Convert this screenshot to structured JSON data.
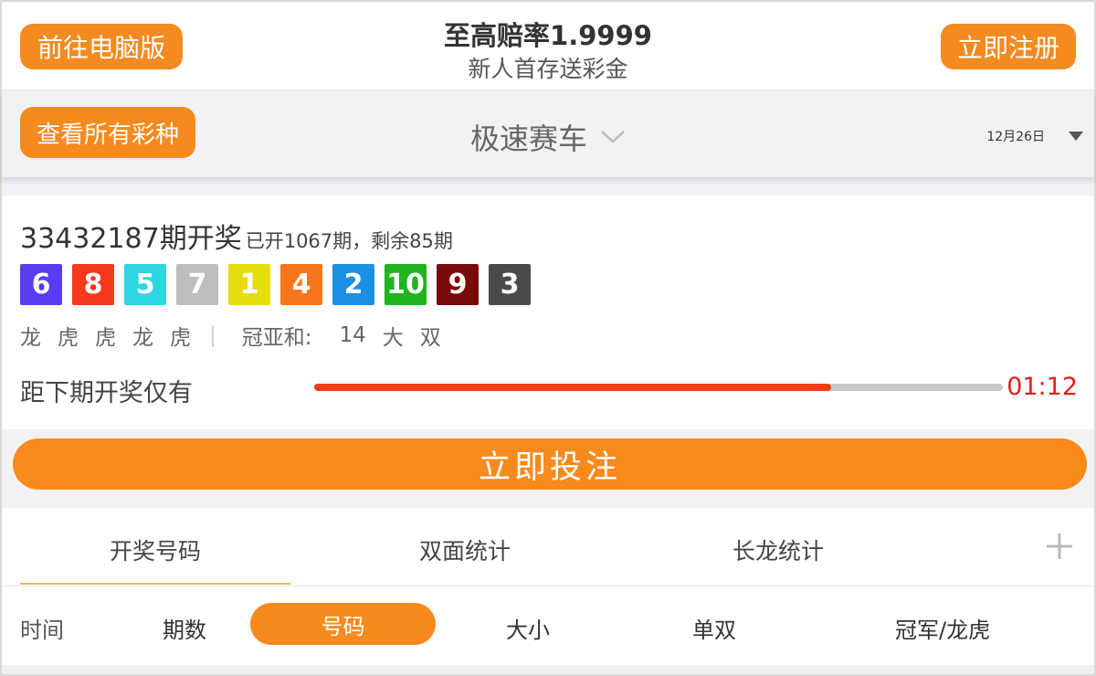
{
  "header": {
    "desktop_button": "前往电脑版",
    "promo_title": "至高赔率1.9999",
    "promo_subtitle": "新人首存送彩金",
    "register_button": "立即注册"
  },
  "selector": {
    "all_lotteries_button": "查看所有彩种",
    "lottery_name": "极速赛车",
    "date": "12月26日"
  },
  "result": {
    "issue": "33432187期开奖",
    "stats": "已开1067期，剩余85期",
    "balls": [
      {
        "num": "6",
        "color": "#5b3df0"
      },
      {
        "num": "8",
        "color": "#f4391c"
      },
      {
        "num": "5",
        "color": "#2fd6e2"
      },
      {
        "num": "7",
        "color": "#bdbdbd"
      },
      {
        "num": "1",
        "color": "#e7dd0c"
      },
      {
        "num": "4",
        "color": "#f7761a"
      },
      {
        "num": "2",
        "color": "#1d8fe3"
      },
      {
        "num": "10",
        "color": "#20b41f"
      },
      {
        "num": "9",
        "color": "#7a0a0a"
      },
      {
        "num": "3",
        "color": "#4a4a4a"
      }
    ],
    "dragon_tiger": [
      "龙",
      "虎",
      "虎",
      "龙",
      "虎"
    ],
    "separator": "|",
    "sum_label": "冠亚和:",
    "sum_value": "14",
    "sum_big_small": "大",
    "sum_odd_even": "双",
    "countdown_label": "距下期开奖仅有",
    "countdown_progress": 0.75,
    "countdown_time": "01:12"
  },
  "bet_button": "立即投注",
  "tabs": [
    "开奖号码",
    "双面统计",
    "长龙统计"
  ],
  "filters": {
    "time": "时间",
    "issue": "期数",
    "number": "号码",
    "size": "大小",
    "odd_even": "单双",
    "champion": "冠军/龙虎"
  },
  "colors": {
    "accent": "#f58a1f",
    "countdown": "#e0201a"
  }
}
